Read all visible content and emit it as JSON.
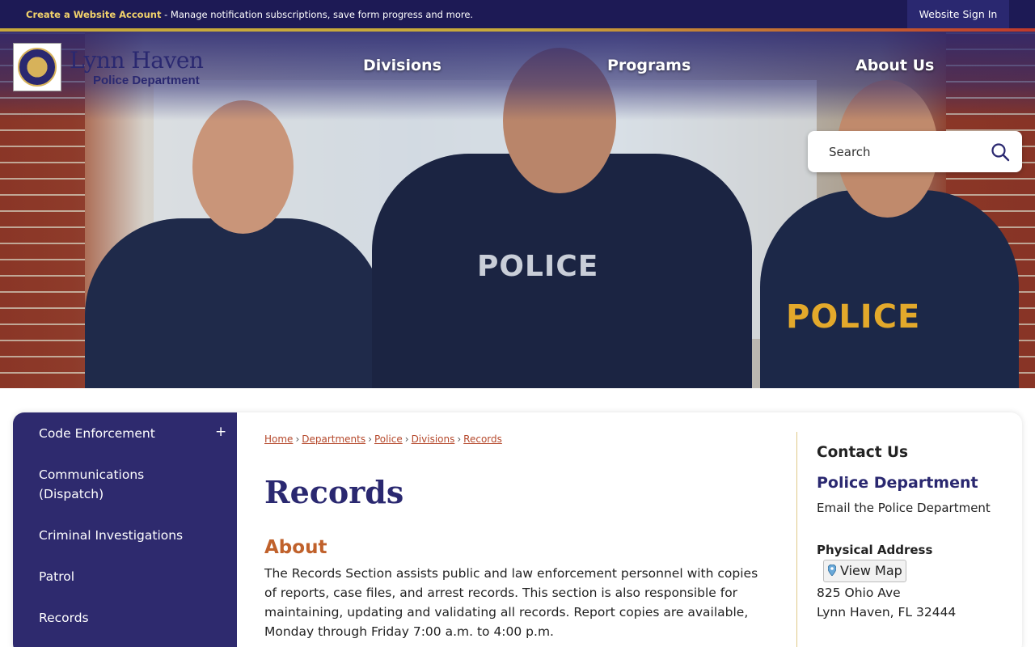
{
  "topbar": {
    "create_account": "Create a Website Account",
    "message": " - Manage notification subscriptions, save form progress and more.",
    "sign_in": "Website Sign In"
  },
  "header": {
    "logo_title": "Lynn Haven",
    "logo_subtitle": "Police Department"
  },
  "nav": {
    "items": [
      "Divisions",
      "Programs",
      "About Us"
    ]
  },
  "hero": {
    "vest_text_center": "POLICE",
    "vest_text_right": "POLICE"
  },
  "search": {
    "placeholder": "Search",
    "icon": "search-icon"
  },
  "sidebar": {
    "items": [
      {
        "label": "Code Enforcement",
        "expand": "+"
      },
      {
        "label": "Communications (Dispatch)"
      },
      {
        "label": "Criminal Investigations"
      },
      {
        "label": "Patrol"
      },
      {
        "label": "Records"
      }
    ]
  },
  "breadcrumb": [
    "Home",
    "Departments",
    "Police",
    "Divisions",
    "Records"
  ],
  "breadcrumb_separator": "›",
  "main": {
    "title": "Records",
    "about_heading": "About",
    "about_text": "The Records Section assists public and law enforcement personnel with copies of reports, case files, and arrest records. This section is also responsible for maintaining, updating and validating all records. Report copies are available, Monday through Friday 7:00 a.m. to 4:00 p.m."
  },
  "contact": {
    "heading": "Contact Us",
    "department": "Police Department",
    "email_link": "Email the Police Department",
    "address_heading": "Physical Address",
    "view_map": "View Map",
    "address_line1": "825 Ohio Ave",
    "address_line2": "Lynn Haven, FL 32444"
  },
  "colors": {
    "brand_navy": "#2a2870",
    "topbar": "#1d1a55",
    "accent_gold": "#f3d36b",
    "link_red": "#b5482b",
    "heading_orange": "#c0612b"
  }
}
